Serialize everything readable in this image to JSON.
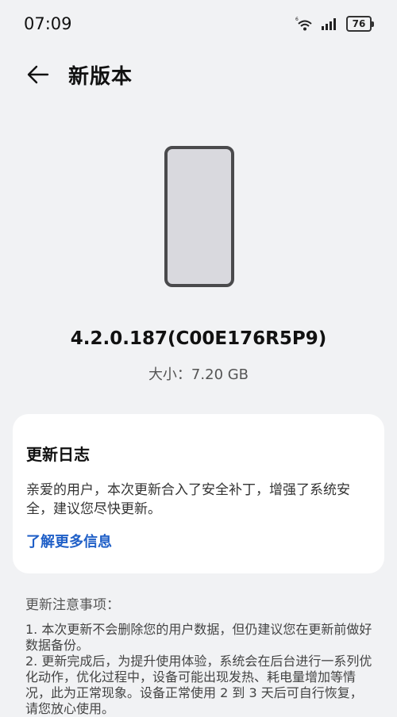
{
  "status": {
    "time": "07:09",
    "battery": "76",
    "icons": [
      "wifi-6-icon",
      "signal-icon",
      "battery-icon"
    ]
  },
  "header": {
    "title": "新版本",
    "back_icon": "back-arrow-icon"
  },
  "update": {
    "version": "4.2.0.187(C00E176R5P9)",
    "size": "大小：7.20 GB"
  },
  "changelog": {
    "title": "更新日志",
    "description": "亲爱的用户，本次更新合入了安全补丁，增强了系统安全，建议您尽快更新。",
    "link": "了解更多信息"
  },
  "notes": {
    "heading": "更新注意事项：",
    "items": [
      "1. 本次更新不会删除您的用户数据，但仍建议您在更新前做好数据备份。",
      "2. 更新完成后，为提升使用体验，系统会在后台进行一系列优化动作，优化过程中，设备可能出现发热、耗电量增加等情况，此为正常现象。设备正常使用 2 到 3 天后可自行恢复，请您放心使用。"
    ]
  },
  "colors": {
    "background": "#f1f2f4",
    "card": "#ffffff",
    "link": "#1f5fc7"
  }
}
